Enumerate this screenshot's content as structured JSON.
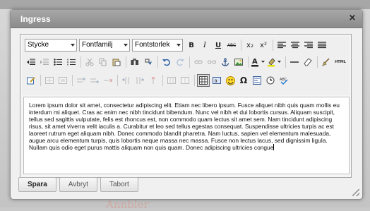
{
  "dialog": {
    "title": "Ingress",
    "close_glyph": "×"
  },
  "background": {
    "text": "Annbler"
  },
  "toolbar": {
    "style_select": "Stycke",
    "font_select": "Fontfamilj",
    "size_select": "Fontstorlek",
    "row1_icons": [
      "bold-icon",
      "italic-icon",
      "underline-icon",
      "strikethrough-icon",
      "subscript-icon",
      "superscript-icon",
      "align-left-icon",
      "align-center-icon",
      "align-right-icon",
      "align-justify-icon"
    ],
    "row2_icons": [
      "outdent-icon",
      "indent-icon",
      "bullet-list-icon",
      "numbered-list-icon",
      "cut-icon",
      "copy-icon",
      "paste-icon",
      "find-icon",
      "replace-icon",
      "undo-icon",
      "redo-icon",
      "link-icon",
      "unlink-icon",
      "anchor-icon",
      "image-icon",
      "text-color-icon",
      "highlight-icon",
      "horizontal-rule-icon",
      "remove-format-icon",
      "cleanup-icon",
      "html-icon"
    ],
    "row3_icons": [
      "edit-icon",
      "table-icon",
      "table-row-icon",
      "insert-row-before-icon",
      "insert-row-after-icon",
      "delete-row-icon",
      "insert-col-before-icon",
      "insert-col-after-icon",
      "delete-col-icon",
      "merge-cells-icon",
      "split-cells-icon",
      "visual-aid-icon",
      "char-map-icon",
      "emoticon-icon",
      "special-char-icon",
      "media-icon",
      "date-icon",
      "spellcheck-icon"
    ],
    "html_label": "HTML",
    "bold_label": "B",
    "italic_label": "I",
    "underline_label": "U",
    "strike_label": "ABC",
    "sub_label": "x₂",
    "sup_label": "x²",
    "omega_label": "Ω"
  },
  "editor": {
    "content": "Lorem ipsum dolor sit amet, consectetur adipiscing elit. Etiam nec libero ipsum. Fusce aliquet nibh quis quam mollis eu interdum mi aliquet. Cras ac enim nec nibh tincidunt bibendum. Nunc vel nibh et dui lobortis cursus. Aliquam suscipit, tellus sed sagittis vulputate, felis est rhoncus est, non commodo quam lectus sit amet sem. Nam tincidunt adipiscing risus, sit amet viverra velit iaculis a. Curabitur et leo sed tellus egestas consequat. Suspendisse ultricies turpis ac est laoreet rutrum eget aliquam nibh. Donec commodo blandit pharetra. Nam luctus, sapien vel elementum malesuada, augue arcu elementum turpis, quis lobortis neque massa nec massa. Fusce non lectus lacus, sed dignissim ligula. Nullam quis odio eget purus mattis aliquam non quis quam. Donec adipiscing ultricies congue"
  },
  "buttons": {
    "save": "Spara",
    "cancel": "Avbryt",
    "remove": "Tabort"
  }
}
